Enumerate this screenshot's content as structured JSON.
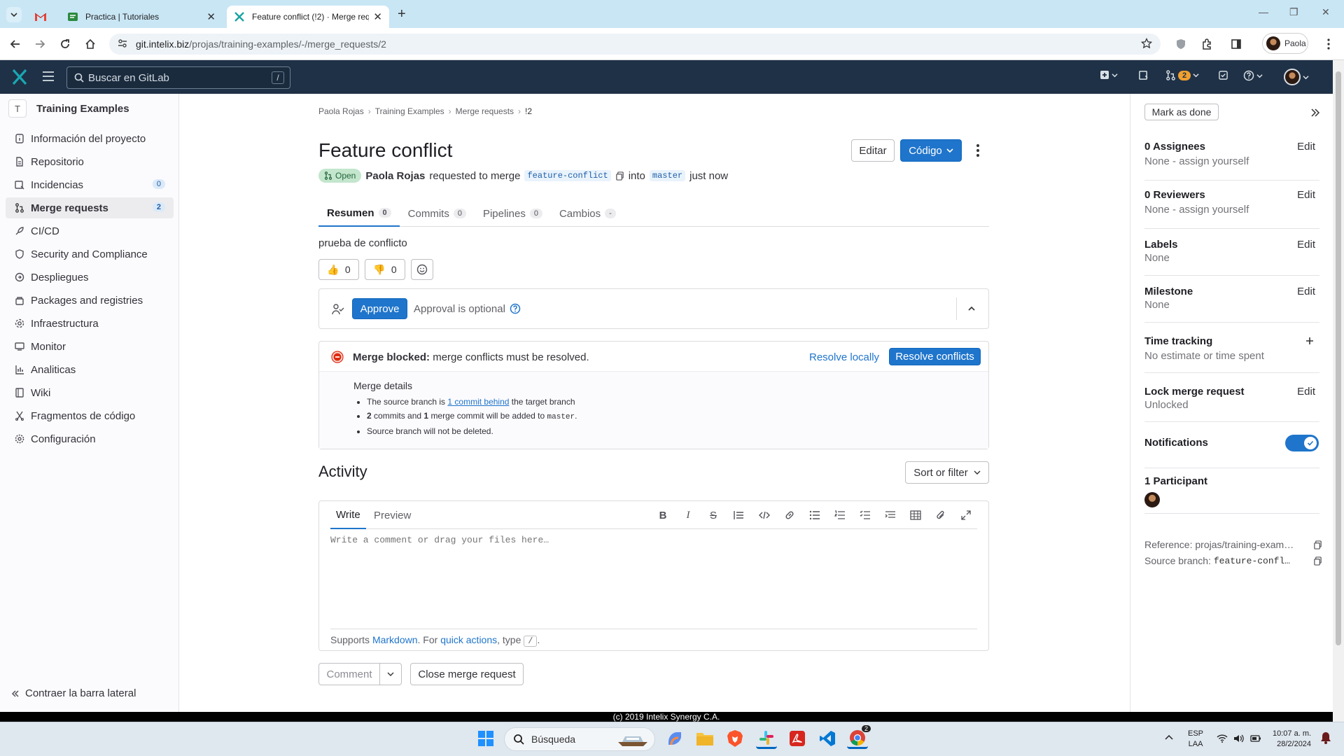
{
  "browser": {
    "tabs": [
      {
        "label": "",
        "icon": "gmail-icon"
      },
      {
        "label": "Practica | Tutoriales",
        "icon": "tutoriales-icon"
      },
      {
        "label": "Feature conflict (!2) · Merge req",
        "icon": "gitlab-x-icon",
        "active": true
      }
    ],
    "url_host": "git.intelix.biz",
    "url_path": "/projas/training-examples/-/merge_requests/2",
    "profile_name": "Paola"
  },
  "gitlab_top": {
    "search_placeholder": "Buscar en GitLab",
    "search_shortcut": "/",
    "merge_requests_count": "2"
  },
  "sidebar": {
    "project_initial": "T",
    "project_name": "Training Examples",
    "items": [
      {
        "label": "Información del proyecto",
        "icon": "info-icon"
      },
      {
        "label": "Repositorio",
        "icon": "document-icon"
      },
      {
        "label": "Incidencias",
        "icon": "issues-icon",
        "count": "0"
      },
      {
        "label": "Merge requests",
        "icon": "merge-request-icon",
        "count": "2",
        "selected": true
      },
      {
        "label": "CI/CD",
        "icon": "rocket-icon"
      },
      {
        "label": "Security and Compliance",
        "icon": "shield-icon"
      },
      {
        "label": "Despliegues",
        "icon": "deploy-icon"
      },
      {
        "label": "Packages and registries",
        "icon": "package-icon"
      },
      {
        "label": "Infraestructura",
        "icon": "infrastructure-icon"
      },
      {
        "label": "Monitor",
        "icon": "monitor-icon"
      },
      {
        "label": "Analiticas",
        "icon": "chart-icon"
      },
      {
        "label": "Wiki",
        "icon": "book-icon"
      },
      {
        "label": "Fragmentos de código",
        "icon": "snippet-icon"
      },
      {
        "label": "Configuración",
        "icon": "settings-icon"
      }
    ],
    "collapse_label": "Contraer la barra lateral"
  },
  "breadcrumb": [
    "Paola Rojas",
    "Training Examples",
    "Merge requests",
    "!2"
  ],
  "mr": {
    "title": "Feature conflict",
    "edit_label": "Editar",
    "code_label": "Código",
    "status": "Open",
    "author": "Paola Rojas",
    "requested_text": "requested to merge",
    "source_branch": "feature-conflict",
    "into_text": "into",
    "target_branch": "master",
    "time": "just now",
    "description": "prueba de conflicto"
  },
  "tabs": [
    {
      "label": "Resumen",
      "count": "0",
      "active": true
    },
    {
      "label": "Commits",
      "count": "0"
    },
    {
      "label": "Pipelines",
      "count": "0"
    },
    {
      "label": "Cambios",
      "count": "-"
    }
  ],
  "reactions": {
    "thumbs_up": "0",
    "thumbs_down": "0"
  },
  "approval": {
    "button": "Approve",
    "text": "Approval is optional"
  },
  "merge": {
    "blocked_bold": "Merge blocked:",
    "blocked_text": "merge conflicts must be resolved.",
    "resolve_locally": "Resolve locally",
    "resolve_conflicts": "Resolve conflicts",
    "details_title": "Merge details",
    "d1_pre": "The source branch is",
    "d1_link": "1 commit behind",
    "d1_post": "the target branch",
    "d2_n1": "2",
    "d2_mid": "commits and",
    "d2_n2": "1",
    "d2_post": "merge commit will be added to",
    "d2_branch": "master",
    "d2_end": ".",
    "d3": "Source branch will not be deleted."
  },
  "activity": {
    "title": "Activity",
    "sort_label": "Sort or filter",
    "write_tab": "Write",
    "preview_tab": "Preview",
    "placeholder": "Write a comment or drag your files here…",
    "supports": "Supports",
    "markdown": "Markdown",
    "for_text": ". For",
    "quick_actions": "quick actions",
    "type_text": ", type",
    "slash": "/",
    "end": ".",
    "comment_button": "Comment",
    "close_button": "Close merge request"
  },
  "right_sidebar": {
    "mark_done": "Mark as done",
    "assignees_title": "0 Assignees",
    "assignees_value": "None - assign yourself",
    "reviewers_title": "0 Reviewers",
    "reviewers_value": "None - assign yourself",
    "labels_title": "Labels",
    "labels_value": "None",
    "milestone_title": "Milestone",
    "milestone_value": "None",
    "time_title": "Time tracking",
    "time_value": "No estimate or time spent",
    "lock_title": "Lock merge request",
    "lock_value": "Unlocked",
    "notifications_title": "Notifications",
    "participants_title": "1 Participant",
    "reference_label": "Reference:",
    "reference_value": "projas/training-exam…",
    "source_label": "Source branch:",
    "source_value": "feature-confl…",
    "edit_label": "Edit"
  },
  "footer": "(c) 2019 Intelix Synergy C.A.",
  "taskbar": {
    "search_placeholder": "Búsqueda",
    "lang_top": "ESP",
    "lang_bottom": "LAA",
    "time": "10:07 a. m.",
    "date": "28/2/2024",
    "chrome_badge": "2"
  },
  "colors": {
    "gitlab_header": "#1f3146",
    "primary_blue": "#1f75cb",
    "danger": "#dd2b0e",
    "open_green": "#c3e6cd"
  }
}
